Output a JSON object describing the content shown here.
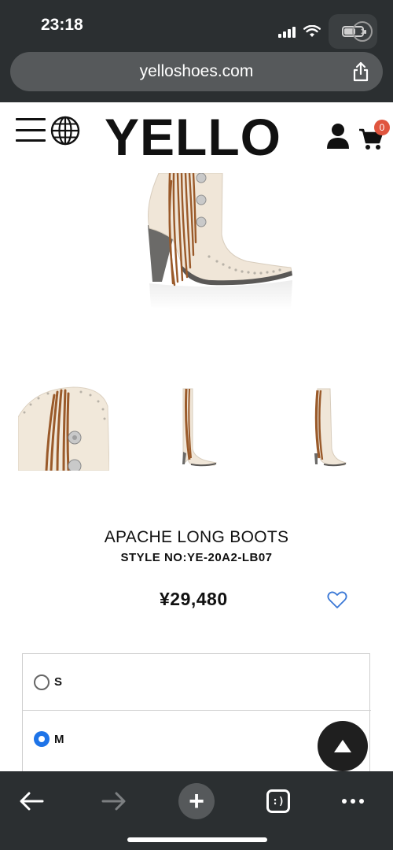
{
  "status_bar": {
    "time": "23:18"
  },
  "browser": {
    "url": "yelloshoes.com"
  },
  "header": {
    "logo": "YELLO",
    "cart_count": "0"
  },
  "product": {
    "name": "APACHE LONG BOOTS",
    "style_no": "STYLE NO:YE-20A2-LB07",
    "price": "¥29,480"
  },
  "sizes": [
    {
      "label": "S",
      "selected": false
    },
    {
      "label": "M",
      "selected": true
    }
  ],
  "toolbar": {
    "tabs_label": ":)"
  },
  "colors": {
    "chrome": "#2b2f31",
    "url_pill": "#56595b",
    "badge": "#e0553e",
    "radio_selected": "#1e74e8",
    "heart": "#3a78d6",
    "boot_leather": "#f0e6d8",
    "fringe": "#9a5a2a"
  }
}
